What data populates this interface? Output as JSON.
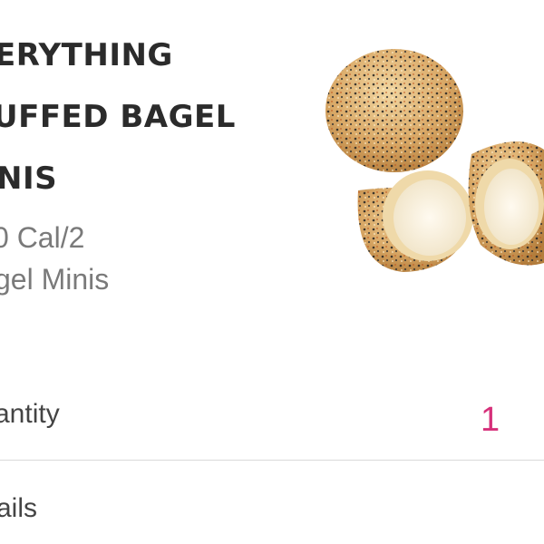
{
  "product": {
    "title_lines": [
      "ERYTHING",
      "UFFED BAGEL",
      "NIS"
    ],
    "calories": "0 Cal/2",
    "serving": "gel Minis"
  },
  "quantity": {
    "label": "antity",
    "value": "1"
  },
  "details": {
    "label": "ails"
  },
  "colors": {
    "accent": "#d6307a",
    "title": "#2b2b2b",
    "subtext": "#7a7a7a"
  }
}
